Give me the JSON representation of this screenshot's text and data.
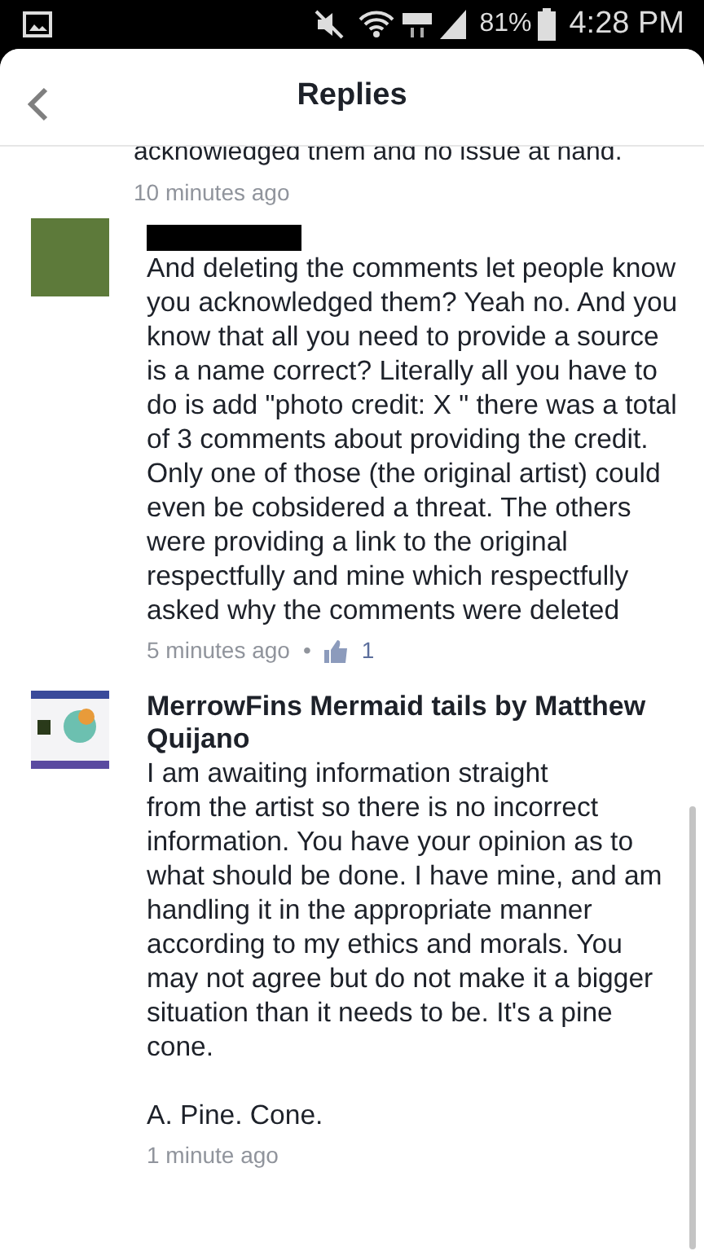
{
  "status_bar": {
    "battery": "81%",
    "time": "4:28 PM"
  },
  "header": {
    "title": "Replies"
  },
  "previous_comment": {
    "text": "acknowledged them and no issue at hand.",
    "time": "10 minutes ago"
  },
  "comments": [
    {
      "author_redacted": true,
      "kind": "photo",
      "text": "And deleting the comments let people know you acknowledged them? Yeah no. And you know that all you need to provide a source is a name correct? Literally all you have to do is add \"photo credit: X \" there was a total of 3 comments about providing the credit. Only one of those (the original artist) could even be cobsidered a threat. The others were providing a link to the original respectfully and mine which respectfully asked why the comments were deleted",
      "time": "5 minutes ago",
      "separator": "•",
      "likes": "1"
    },
    {
      "author_redacted": false,
      "author": "MerrowFins Mermaid tails by Matthew Quijano",
      "kind": "logo",
      "text": "I am awaiting information straight\nfrom the artist so there is no incorrect information. You have your opinion as to what should be done. I have mine, and am handling it in the appropriate manner according to my ethics and morals. You may not agree but do not make it a bigger situation than it needs to be. It's a pine cone.\n\nA. Pine. Cone.",
      "time": "1 minute ago"
    }
  ]
}
